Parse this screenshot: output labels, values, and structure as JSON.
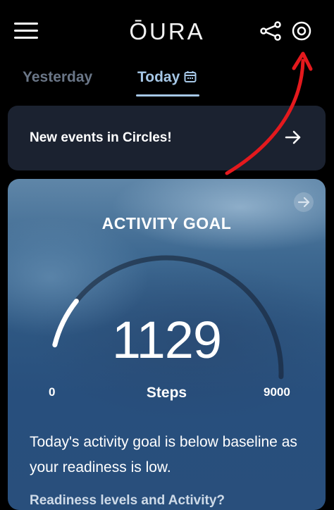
{
  "header": {
    "logo": "ŌURA",
    "menu_icon": "hamburger-menu-icon",
    "share_icon": "share-icon",
    "ring_icon": "ring-icon"
  },
  "tabs": [
    {
      "label": "Yesterday",
      "active": false
    },
    {
      "label": "Today",
      "active": true,
      "icon": "calendar-icon"
    }
  ],
  "events_card": {
    "label": "New events in Circles!",
    "icon": "arrow-right-icon"
  },
  "activity_card": {
    "title": "ACTIVITY GOAL",
    "steps": "1129",
    "unit": "Steps",
    "scale_min": "0",
    "scale_max": "9000",
    "progress": 0.125,
    "description": "Today's activity goal is below baseline as your readiness is low.",
    "footer": "Readiness levels and Activity?"
  },
  "colors": {
    "accent": "#a6c7e6",
    "inactive_tab": "#6a7687",
    "annotation_arrow": "#e4191d",
    "card_background": "#1b2230"
  }
}
